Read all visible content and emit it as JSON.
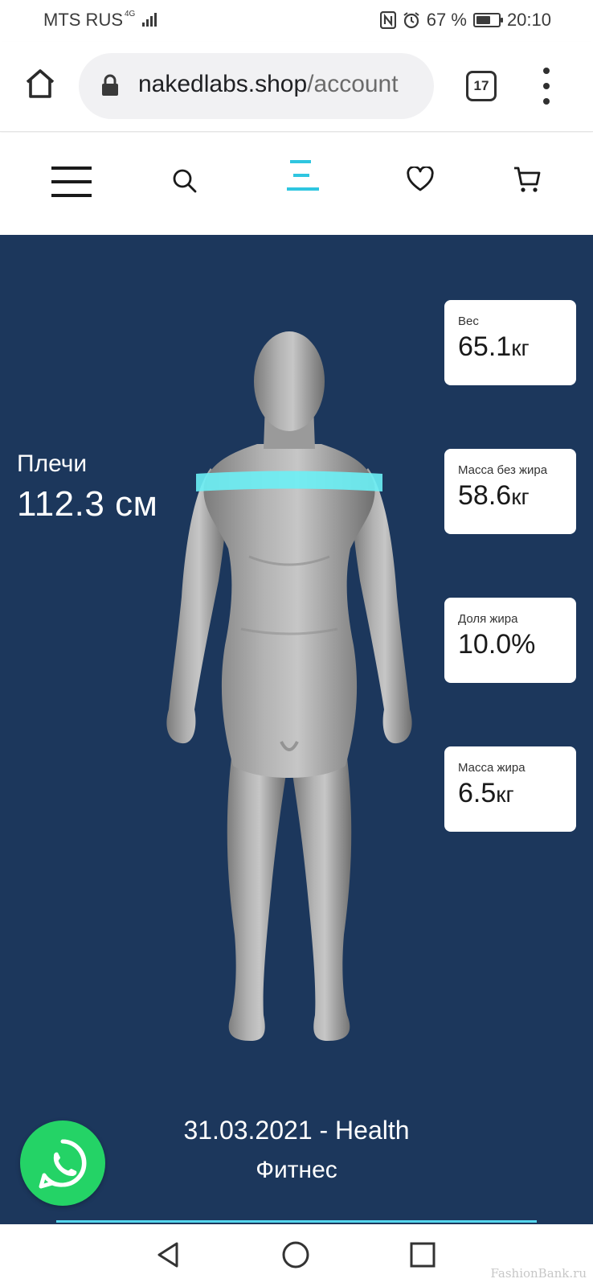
{
  "status_bar": {
    "carrier": "MTS RUS",
    "network": "4G",
    "battery_percent": "67 %",
    "battery_level": 0.67,
    "time": "20:10"
  },
  "browser": {
    "url_domain": "nakedlabs.shop",
    "url_path": "/account",
    "tab_count": "17",
    "icons": [
      "home-icon",
      "lock-icon",
      "tab-switcher-icon",
      "overflow-menu-icon"
    ]
  },
  "site_nav": {
    "icons": [
      "hamburger-menu-icon",
      "search-icon",
      "brand-logo-icon",
      "wishlist-heart-icon",
      "cart-icon"
    ],
    "accent_color": "#2fc6e0"
  },
  "hero": {
    "background_color": "#1c375c",
    "measurement": {
      "label": "Плечи",
      "value": "112.3 см"
    },
    "stats": [
      {
        "label": "Вес",
        "value": "65.1",
        "unit": "кг"
      },
      {
        "label": "Масса без жира",
        "value": "58.6",
        "unit": "кг"
      },
      {
        "label": "Доля жира",
        "value": "10.0%",
        "unit": ""
      },
      {
        "label": "Масса жира",
        "value": "6.5",
        "unit": "кг"
      }
    ],
    "scan_date_line": "31.03.2021 - Health",
    "program": "Фитнес",
    "highlight_color": "#6cf0f5"
  },
  "whatsapp": {
    "icon": "whatsapp-icon",
    "color": "#24d366"
  },
  "system_nav": {
    "icons": [
      "back-icon",
      "home-circle-icon",
      "recents-icon"
    ]
  },
  "watermark": "FashionBank.ru"
}
